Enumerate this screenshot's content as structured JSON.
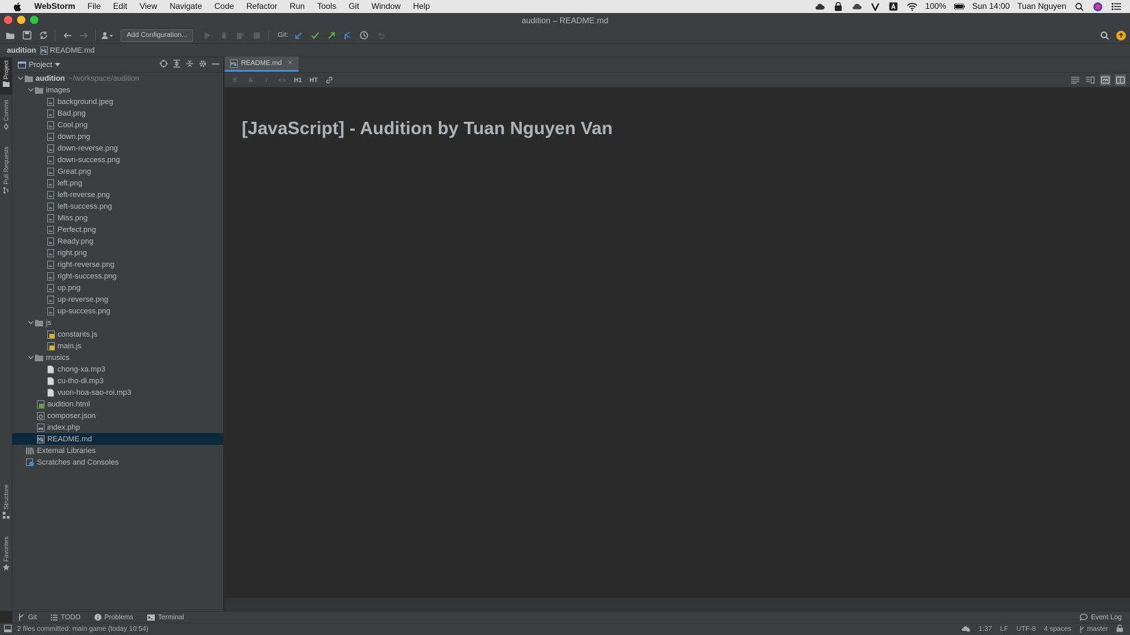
{
  "macMenuBar": {
    "appName": "WebStorm",
    "menus": [
      "File",
      "Edit",
      "View",
      "Navigate",
      "Code",
      "Refactor",
      "Run",
      "Tools",
      "Git",
      "Window",
      "Help"
    ],
    "battery": "100%",
    "clock": "Sun 14:00",
    "user": "Tuan Nguyen"
  },
  "window": {
    "title": "audition – README.md"
  },
  "toolbar": {
    "configuration": "Add Configuration...",
    "git_label": "Git:",
    "accent_color": "#e9a31f"
  },
  "breadcrumb": {
    "project": "audition",
    "file": "README.md"
  },
  "sideStripe": {
    "project": "Project",
    "commit": "Commit",
    "pullRequests": "Pull Requests",
    "structure": "Structure",
    "favorites": "Favorites"
  },
  "projectPanel": {
    "title": "Project",
    "root": "audition",
    "rootPath": "~/workspace/audition",
    "folders": {
      "images": "images",
      "js": "js",
      "musics": "musics"
    },
    "images": [
      "background.jpeg",
      "Bad.png",
      "Cool.png",
      "down.png",
      "down-reverse.png",
      "down-success.png",
      "Great.png",
      "left.png",
      "left-reverse.png",
      "left-success.png",
      "Miss.png",
      "Perfect.png",
      "Ready.png",
      "right.png",
      "right-reverse.png",
      "right-success.png",
      "up.png",
      "up-reverse.png",
      "up-success.png"
    ],
    "js": [
      "constants.js",
      "main.js"
    ],
    "musics": [
      "chong-xa.mp3",
      "cu-tho-di.mp3",
      "vuon-hoa-sao-roi.mp3"
    ],
    "rootFiles": [
      "audition.html",
      "composer.json",
      "index.php",
      "README.md"
    ],
    "selected": "README.md",
    "externalLibraries": "External Libraries",
    "scratches": "Scratches and Consoles"
  },
  "editor": {
    "tab": "README.md",
    "mdTools": [
      "B",
      "S",
      "I",
      "<>",
      "H1",
      "HT"
    ],
    "heading": "[JavaScript] - Audition by Tuan Nguyen Van"
  },
  "bottomBar": {
    "git": "Git",
    "todo": "TODO",
    "problems": "Problems",
    "terminal": "Terminal",
    "eventLog": "Event Log"
  },
  "statusBar": {
    "message": "2 files committed: main game (today 10:54)",
    "position": "1:37",
    "lineSeparator": "LF",
    "encoding": "UTF-8",
    "indent": "4 spaces",
    "branch": "master"
  }
}
